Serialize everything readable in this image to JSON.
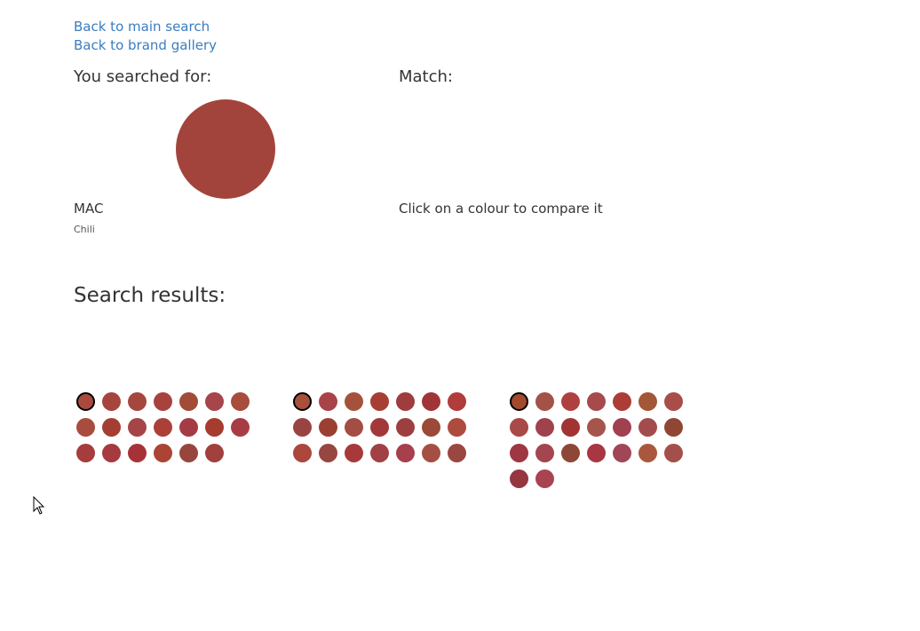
{
  "links": {
    "main_search": "Back to main search",
    "brand_gallery": "Back to brand gallery"
  },
  "searched": {
    "heading": "You searched for:",
    "brand": "MAC",
    "shade": "Chili",
    "color": "#a3443c"
  },
  "match": {
    "heading": "Match:",
    "hint": "Click on a colour to compare it"
  },
  "results": {
    "heading": "Search results:",
    "groups": [
      [
        "#a84a3e",
        "#a5453e",
        "#a5473e",
        "#a7423f",
        "#a04c38",
        "#a6454a",
        "#a84c3c",
        "#a84c3e",
        "#a53e32",
        "#a64548",
        "#ab4039",
        "#a53c45",
        "#a53c2e",
        "#a83c44",
        "#a63c3c",
        "#a53a40",
        "#a63238",
        "#ab4434",
        "#97463e",
        "#a2403d"
      ],
      [
        "#a8503c",
        "#a84449",
        "#a4523b",
        "#a63e33",
        "#9e3c3e",
        "#a03537",
        "#b03c3c",
        "#994443",
        "#9b3f31",
        "#a34d45",
        "#a3383b",
        "#9d3f3e",
        "#9a4a36",
        "#ad4b3e",
        "#ab473c",
        "#984640",
        "#a8393a",
        "#a14145",
        "#a6404d",
        "#a54e44",
        "#9a4641"
      ],
      [
        "#a3492e",
        "#a35247",
        "#b0403f",
        "#a64a4e",
        "#ac3c36",
        "#a35737",
        "#a84d49",
        "#a84a47",
        "#a0424d",
        "#a23335",
        "#a5554b",
        "#a04050",
        "#a34c4d",
        "#8f4734",
        "#9f3643",
        "#a3464f",
        "#8e4636",
        "#a83643",
        "#a14656",
        "#a9583e",
        "#a34f4b",
        "#953641",
        "#a94352"
      ]
    ]
  }
}
